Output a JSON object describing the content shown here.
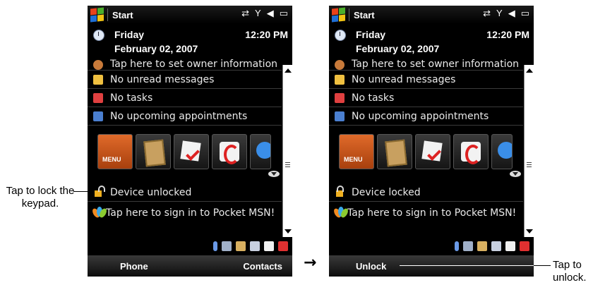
{
  "left_device": {
    "title": "Start",
    "status_icons": [
      "connectivity-icon",
      "signal-icon",
      "volume-icon",
      "battery-icon"
    ],
    "date": {
      "day": "Friday",
      "full_date": "February 02, 2007",
      "time": "12:20 PM"
    },
    "items": [
      {
        "icon": "owner-icon",
        "label": "Tap here to set owner information"
      },
      {
        "icon": "mail-icon",
        "label": "No unread messages"
      },
      {
        "icon": "task-icon",
        "label": "No tasks"
      },
      {
        "icon": "calendar-icon",
        "label": "No upcoming appointments"
      }
    ],
    "apps": [
      {
        "icon": "mio-menu-icon",
        "label": "MENU"
      },
      {
        "icon": "photo-frame-icon"
      },
      {
        "icon": "checkmark-icon"
      },
      {
        "icon": "phone-icon"
      },
      {
        "icon": "internet-explorer-icon"
      }
    ],
    "lock_status": "Device unlocked",
    "msn_text": "Tap here to sign in to Pocket MSN!",
    "softkeys": {
      "left": "Phone",
      "right": "Contacts"
    }
  },
  "right_device": {
    "title": "Start",
    "date": {
      "day": "Friday",
      "full_date": "February 02, 2007",
      "time": "12:20 PM"
    },
    "items": [
      {
        "icon": "owner-icon",
        "label": "Tap here to set owner information"
      },
      {
        "icon": "mail-icon",
        "label": "No unread messages"
      },
      {
        "icon": "task-icon",
        "label": "No tasks"
      },
      {
        "icon": "calendar-icon",
        "label": "No upcoming appointments"
      }
    ],
    "lock_status": "Device locked",
    "msn_text": "Tap here to sign in to Pocket MSN!",
    "softkeys": {
      "left": "Unlock"
    }
  },
  "callouts": {
    "lock": "Tap to lock the keypad.",
    "unlock": "Tap to unlock."
  },
  "colors": {
    "screen_bg": "#000000",
    "text": "#ffffff",
    "lock_icon": "#f0b020"
  }
}
